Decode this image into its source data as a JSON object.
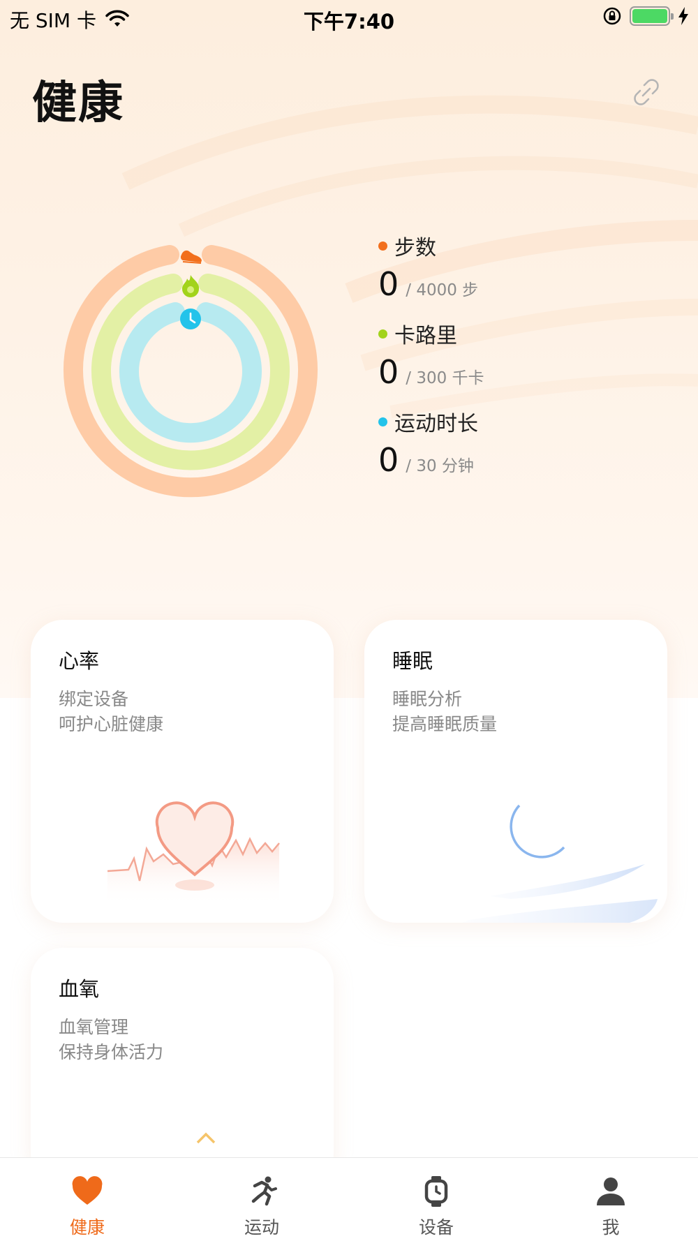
{
  "status_bar": {
    "carrier": "无 SIM 卡",
    "time": "下午7:40"
  },
  "header": {
    "title": "健康"
  },
  "activity": {
    "metrics": [
      {
        "label": "步数",
        "value": "0",
        "goal": "/ 4000 步",
        "color": "#f26f1c",
        "progress": 0
      },
      {
        "label": "卡路里",
        "value": "0",
        "goal": "/ 300 千卡",
        "color": "#a2d31b",
        "progress": 0
      },
      {
        "label": "运动时长",
        "value": "0",
        "goal": "/ 30 分钟",
        "color": "#23c3ea",
        "progress": 0
      }
    ],
    "ring_colors": {
      "outer": "#fecba6",
      "middle": "#e3f0a5",
      "inner": "#b7eaf0"
    }
  },
  "cards": {
    "heart_rate": {
      "title": "心率",
      "line1": "绑定设备",
      "line2": "呵护心脏健康"
    },
    "sleep": {
      "title": "睡眠",
      "line1": "睡眠分析",
      "line2": "提高睡眠质量"
    },
    "blood_oxygen": {
      "title": "血氧",
      "line1": "血氧管理",
      "line2": "保持身体活力"
    }
  },
  "tab_bar": {
    "items": [
      {
        "label": "健康",
        "icon": "heart-icon",
        "active": true
      },
      {
        "label": "运动",
        "icon": "running-icon",
        "active": false
      },
      {
        "label": "设备",
        "icon": "watch-icon",
        "active": false
      },
      {
        "label": "我",
        "icon": "person-icon",
        "active": false
      }
    ],
    "active_color": "#ef6a1a",
    "inactive_color": "#555555"
  }
}
